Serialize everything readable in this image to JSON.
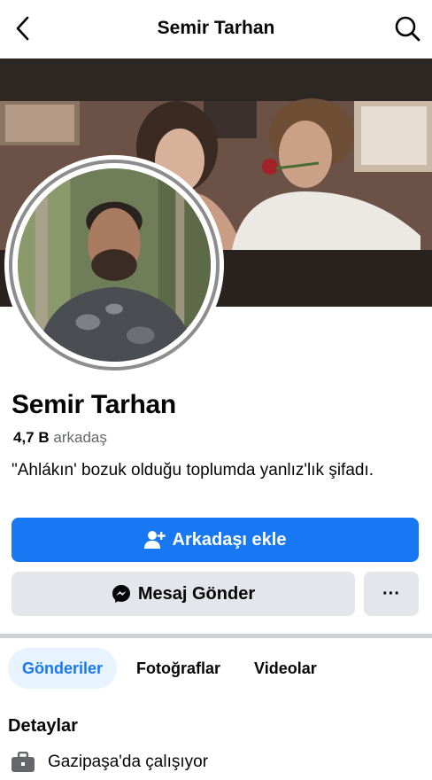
{
  "header": {
    "title": "Semir Tarhan",
    "back_icon": "back-arrow-icon",
    "search_icon": "search-icon"
  },
  "profile": {
    "name": "Semir Tarhan",
    "friends_count": "4,7 B",
    "friends_label": "arkadaş",
    "bio": "\"Ahlákın' bozuk olduğu toplumda yanlız'lık şifadı."
  },
  "actions": {
    "add_friend_label": "Arkadaşı ekle",
    "message_label": "Mesaj Gönder",
    "more_label": "···"
  },
  "tabs": [
    {
      "label": "Gönderiler",
      "active": true
    },
    {
      "label": "Fotoğraflar",
      "active": false
    },
    {
      "label": "Videolar",
      "active": false
    }
  ],
  "details": {
    "title": "Detaylar",
    "work": "Gazipaşa'da çalışıyor"
  },
  "colors": {
    "primary": "#1877f2",
    "button_gray": "#e4e6eb",
    "tab_active_bg": "#e7f3ff",
    "secondary_text": "#65676b"
  }
}
